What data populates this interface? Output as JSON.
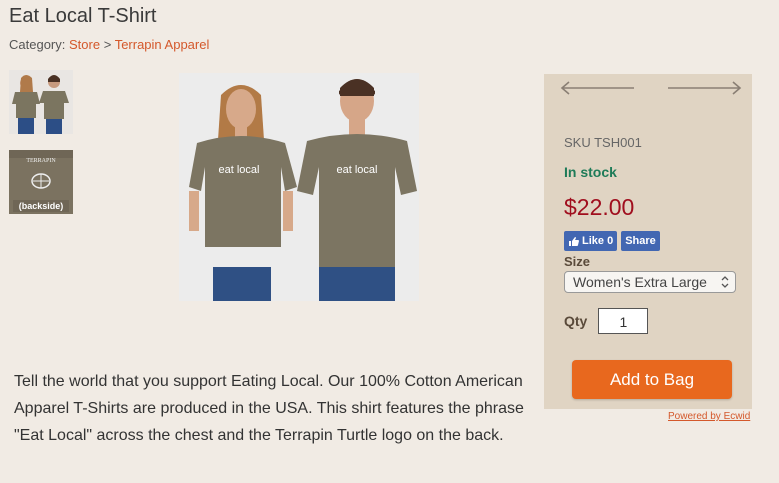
{
  "product": {
    "title": "Eat Local T-Shirt",
    "category_label": "Category:",
    "breadcrumb": [
      "Store",
      "Terrapin Apparel"
    ],
    "breadcrumb_sep": ">",
    "thumb2_text": "(backside)",
    "shirt_text": "eat local",
    "sku": "SKU TSH001",
    "stock": "In stock",
    "price": "$22.00",
    "fb_like": "Like 0",
    "fb_share": "Share",
    "size_label": "Size",
    "size_value": "Women's Extra Large",
    "qty_label": "Qty",
    "qty_value": "1",
    "add_button": "Add to Bag",
    "powered_by": "Powered by Ecwid",
    "description": "Tell the world that you support Eating Local. Our 100% Cotton American Apparel T-Shirts are produced in the USA. This shirt features the phrase \"Eat Local\" across the chest and the Terrapin Turtle logo on the back."
  },
  "colors": {
    "accent": "#e8681e",
    "price": "#a00e1e",
    "stock": "#1e7b58",
    "link": "#d4582b"
  }
}
